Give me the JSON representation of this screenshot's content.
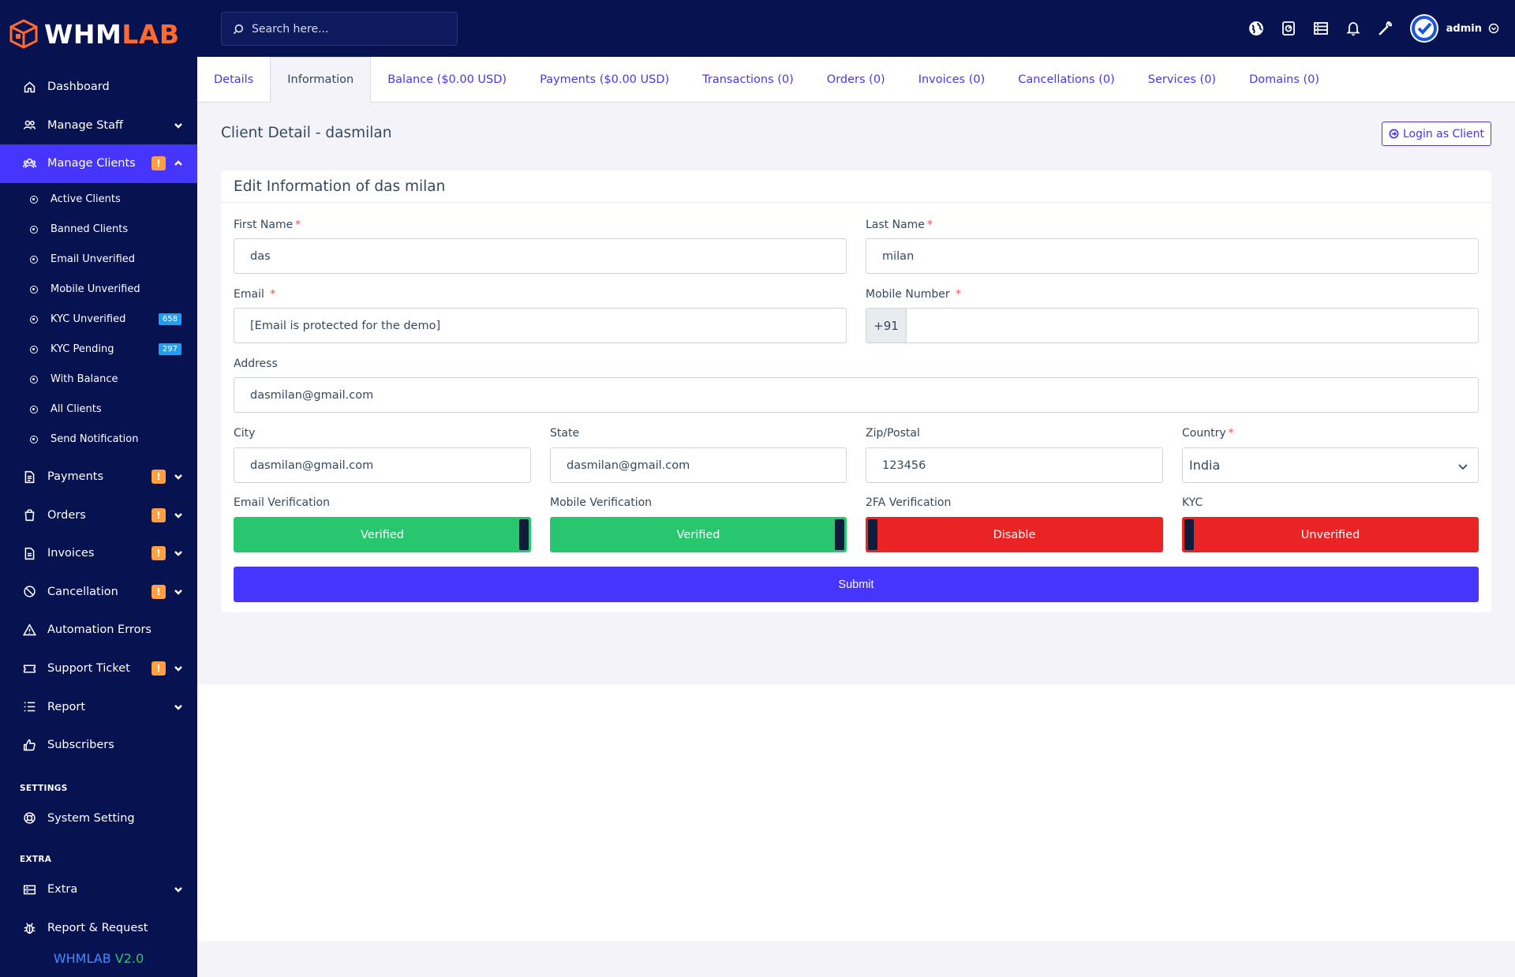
{
  "brand": {
    "logo_left": "WHM",
    "logo_right": "LAB",
    "version_name": "WHMLAB",
    "version_num": "V2.0"
  },
  "sidebar": {
    "top_items": [
      {
        "label": "Dashboard",
        "icon": "home-icon"
      },
      {
        "label": "Manage Staff",
        "icon": "users-icon"
      },
      {
        "label": "Manage Clients",
        "icon": "clients-icon",
        "badge": "!"
      }
    ],
    "sub_items": [
      {
        "label": "Active Clients"
      },
      {
        "label": "Banned Clients"
      },
      {
        "label": "Email Unverified"
      },
      {
        "label": "Mobile Unverified"
      },
      {
        "label": "KYC Unverified",
        "count": "658"
      },
      {
        "label": "KYC Pending",
        "count": "297"
      },
      {
        "label": "With Balance"
      },
      {
        "label": "All Clients"
      },
      {
        "label": "Send Notification"
      }
    ],
    "items": [
      {
        "label": "Payments",
        "badge": "!"
      },
      {
        "label": "Orders",
        "badge": "!"
      },
      {
        "label": "Invoices",
        "badge": "!"
      },
      {
        "label": "Cancellation",
        "badge": "!"
      },
      {
        "label": "Automation Errors"
      },
      {
        "label": "Support Ticket",
        "badge": "!"
      },
      {
        "label": "Report"
      },
      {
        "label": "Subscribers"
      }
    ],
    "settings_title": "SETTINGS",
    "settings_items": [
      {
        "label": "System Setting"
      }
    ],
    "extra_title": "EXTRA",
    "extra_items": [
      {
        "label": "Extra"
      },
      {
        "label": "Report & Request"
      }
    ]
  },
  "topbar": {
    "search_placeholder": "Search here...",
    "admin_name": "admin"
  },
  "tabs": [
    {
      "label": "Details"
    },
    {
      "label": "Information",
      "active": true
    },
    {
      "label": "Balance ($0.00 USD)"
    },
    {
      "label": "Payments ($0.00 USD)"
    },
    {
      "label": "Transactions (0)"
    },
    {
      "label": "Orders (0)"
    },
    {
      "label": "Invoices (0)"
    },
    {
      "label": "Cancellations (0)"
    },
    {
      "label": "Services (0)"
    },
    {
      "label": "Domains (0)"
    }
  ],
  "page": {
    "title": "Client Detail - dasmilan",
    "login_button": "Login as Client"
  },
  "form": {
    "heading": "Edit Information of das milan",
    "first_name_label": "First Name",
    "first_name": "das",
    "last_name_label": "Last Name",
    "last_name": "milan",
    "email_label": "Email",
    "email": "[Email is protected for the demo]",
    "mobile_label": "Mobile Number",
    "mobile_prefix": "+91",
    "mobile": "",
    "address_label": "Address",
    "address": "dasmilan@gmail.com",
    "city_label": "City",
    "city": "dasmilan@gmail.com",
    "state_label": "State",
    "state": "dasmilan@gmail.com",
    "zip_label": "Zip/Postal",
    "zip": "123456",
    "country_label": "Country",
    "country": "India",
    "required_mark": "*",
    "email_verification_label": "Email Verification",
    "email_verification": "Verified",
    "mobile_verification_label": "Mobile Verification",
    "mobile_verification": "Verified",
    "twofa_label": "2FA Verification",
    "twofa": "Disable",
    "kyc_label": "KYC",
    "kyc": "Unverified",
    "submit": "Submit"
  },
  "colors": {
    "sidebar_bg": "#071251",
    "accent": "#4634ff",
    "success": "#28c76f",
    "danger": "#ea2424",
    "warning": "#ff9f43",
    "page_bg": "#f3f3f9"
  }
}
